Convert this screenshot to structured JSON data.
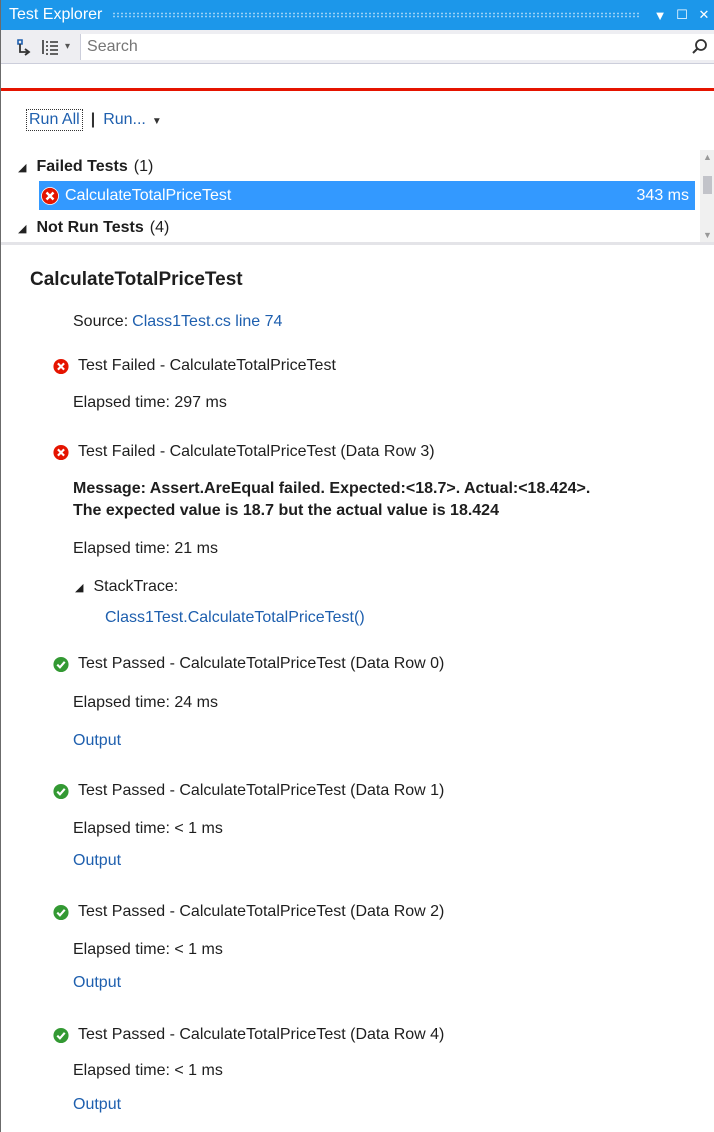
{
  "window": {
    "title": "Test Explorer",
    "controls": {
      "dropdown": "▼",
      "maximize": "☐",
      "close": "✕"
    }
  },
  "toolbar": {
    "search_placeholder": "Search",
    "icons": [
      "group-by-icon",
      "list-view-icon",
      "search-icon"
    ]
  },
  "colors": {
    "accent": "#1c97ea",
    "selected_row": "#3399ff",
    "failure_bar": "#e51400",
    "fail_icon": "#e51400",
    "pass_icon": "#339933",
    "link": "#1e5fae"
  },
  "run": {
    "run_all": "Run All",
    "separator": "|",
    "run_dropdown": "Run..."
  },
  "groups": [
    {
      "name": "Failed Tests",
      "count": "(1)"
    },
    {
      "name": "Not Run Tests",
      "count": "(4)"
    }
  ],
  "selected_test": {
    "name": "CalculateTotalPriceTest",
    "duration": "343 ms",
    "status": "failed"
  },
  "detail": {
    "title": "CalculateTotalPriceTest",
    "source_label": "Source:",
    "source_link": "Class1Test.cs line 74",
    "results": [
      {
        "status": "failed",
        "heading": "Test Failed - CalculateTotalPriceTest",
        "elapsed": "Elapsed time: 297 ms"
      },
      {
        "status": "failed",
        "heading": "Test Failed - CalculateTotalPriceTest (Data Row 3)",
        "message_line1": "Message: Assert.AreEqual failed. Expected:<18.7>. Actual:<18.424>.",
        "message_line2": "The expected value is 18.7 but the actual value is 18.424",
        "elapsed": "Elapsed time: 21 ms",
        "stacktrace_label": "StackTrace:",
        "stacktrace_link": "Class1Test.CalculateTotalPriceTest()"
      },
      {
        "status": "passed",
        "heading": "Test Passed - CalculateTotalPriceTest (Data Row 0)",
        "elapsed": "Elapsed time: 24 ms",
        "output": "Output"
      },
      {
        "status": "passed",
        "heading": "Test Passed - CalculateTotalPriceTest (Data Row 1)",
        "elapsed": "Elapsed time: < 1 ms",
        "output": "Output"
      },
      {
        "status": "passed",
        "heading": "Test Passed - CalculateTotalPriceTest (Data Row 2)",
        "elapsed": "Elapsed time: < 1 ms",
        "output": "Output"
      },
      {
        "status": "passed",
        "heading": "Test Passed - CalculateTotalPriceTest (Data Row 4)",
        "elapsed": "Elapsed time: < 1 ms",
        "output": "Output"
      }
    ]
  }
}
